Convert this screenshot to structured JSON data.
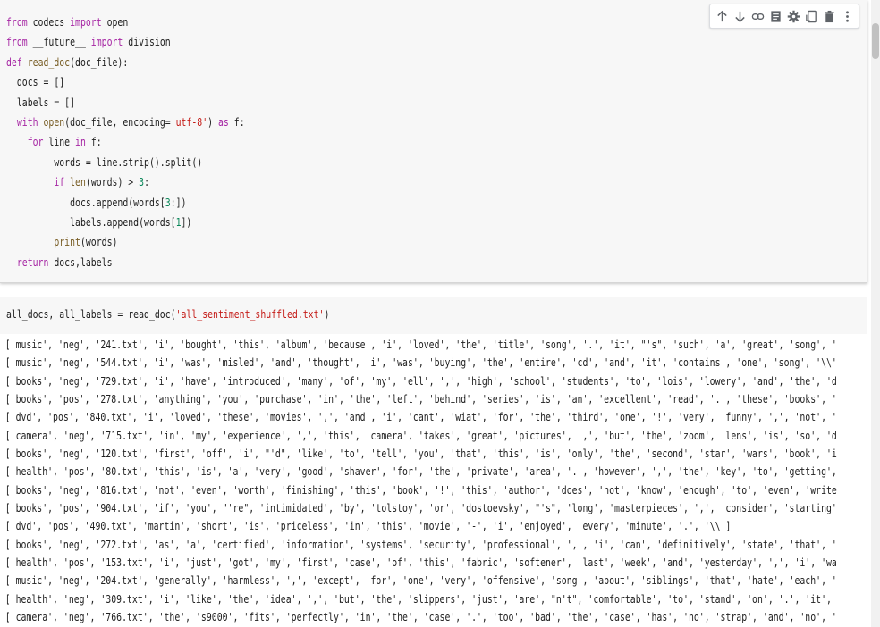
{
  "toolbar": {
    "icons": [
      "arrow-up-icon",
      "arrow-down-icon",
      "link-icon",
      "comment-icon",
      "gear-icon",
      "mirror-cell-icon",
      "delete-icon",
      "more-vert-icon"
    ]
  },
  "cell1": {
    "lines": [
      "from codecs import open",
      "from __future__ import division",
      "def read_doc(doc_file):",
      "  docs = []",
      "  labels = []",
      "  with open(doc_file, encoding='utf-8') as f:",
      "    for line in f:",
      "         words = line.strip().split()",
      "         if len(words) > 3:",
      "            docs.append(words[3:])",
      "            labels.append(words[1])",
      "         print(words)",
      "  return docs,labels"
    ]
  },
  "cell2": {
    "code": "all_docs, all_labels = read_doc('all_sentiment_shuffled.txt')"
  },
  "output": {
    "lines": [
      "['music', 'neg', '241.txt', 'i', 'bought', 'this', 'album', 'because', 'i', 'loved', 'the', 'title', 'song', '.', 'it', \"'s\", 'such', 'a', 'great', 'song', '",
      "['music', 'neg', '544.txt', 'i', 'was', 'misled', 'and', 'thought', 'i', 'was', 'buying', 'the', 'entire', 'cd', 'and', 'it', 'contains', 'one', 'song', '\\\\'",
      "['books', 'neg', '729.txt', 'i', 'have', 'introduced', 'many', 'of', 'my', 'ell', ',', 'high', 'school', 'students', 'to', 'lois', 'lowery', 'and', 'the', 'd",
      "['books', 'pos', '278.txt', 'anything', 'you', 'purchase', 'in', 'the', 'left', 'behind', 'series', 'is', 'an', 'excellent', 'read', '.', 'these', 'books', '",
      "['dvd', 'pos', '840.txt', 'i', 'loved', 'these', 'movies', ',', 'and', 'i', 'cant', 'wiat', 'for', 'the', 'third', 'one', '!', 'very', 'funny', ',', 'not', '",
      "['camera', 'neg', '715.txt', 'in', 'my', 'experience', ',', 'this', 'camera', 'takes', 'great', 'pictures', ',', 'but', 'the', 'zoom', 'lens', 'is', 'so', 'd",
      "['books', 'neg', '120.txt', 'first', 'off', 'i', \"'d\", 'like', 'to', 'tell', 'you', 'that', 'this', 'is', 'only', 'the', 'second', 'star', 'wars', 'book', 'i",
      "['health', 'pos', '80.txt', 'this', 'is', 'a', 'very', 'good', 'shaver', 'for', 'the', 'private', 'area', '.', 'however', ',', 'the', 'key', 'to', 'getting',",
      "['books', 'neg', '816.txt', 'not', 'even', 'worth', 'finishing', 'this', 'book', '!', 'this', 'author', 'does', 'not', 'know', 'enough', 'to', 'even', 'write",
      "['books', 'pos', '904.txt', 'if', 'you', \"'re\", 'intimidated', 'by', 'tolstoy', 'or', 'dostoevsky', \"'s\", 'long', 'masterpieces', ',', 'consider', 'starting'",
      "['dvd', 'pos', '490.txt', 'martin', 'short', 'is', 'priceless', 'in', 'this', 'movie', '-', 'i', 'enjoyed', 'every', 'minute', '.', '\\\\']",
      "['books', 'neg', '272.txt', 'as', 'a', 'certified', 'information', 'systems', 'security', 'professional', ',', 'i', 'can', 'definitively', 'state', 'that', '",
      "['health', 'pos', '153.txt', 'i', 'just', 'got', 'my', 'first', 'case', 'of', 'this', 'fabric', 'softener', 'last', 'week', 'and', 'yesterday', ',', 'i', 'wa",
      "['music', 'neg', '204.txt', 'generally', 'harmless', ',', 'except', 'for', 'one', 'very', 'offensive', 'song', 'about', 'siblings', 'that', 'hate', 'each', '",
      "['health', 'neg', '309.txt', 'i', 'like', 'the', 'idea', ',', 'but', 'the', 'slippers', 'just', 'are', \"n't\", 'comfortable', 'to', 'stand', 'on', '.', 'it',",
      "['camera', 'neg', '766.txt', 'the', 's9000', 'fits', 'perfectly', 'in', 'the', 'case', '.', 'too', 'bad', 'the', 'case', 'has', 'no', 'strap', 'and', 'no', '"
    ]
  }
}
